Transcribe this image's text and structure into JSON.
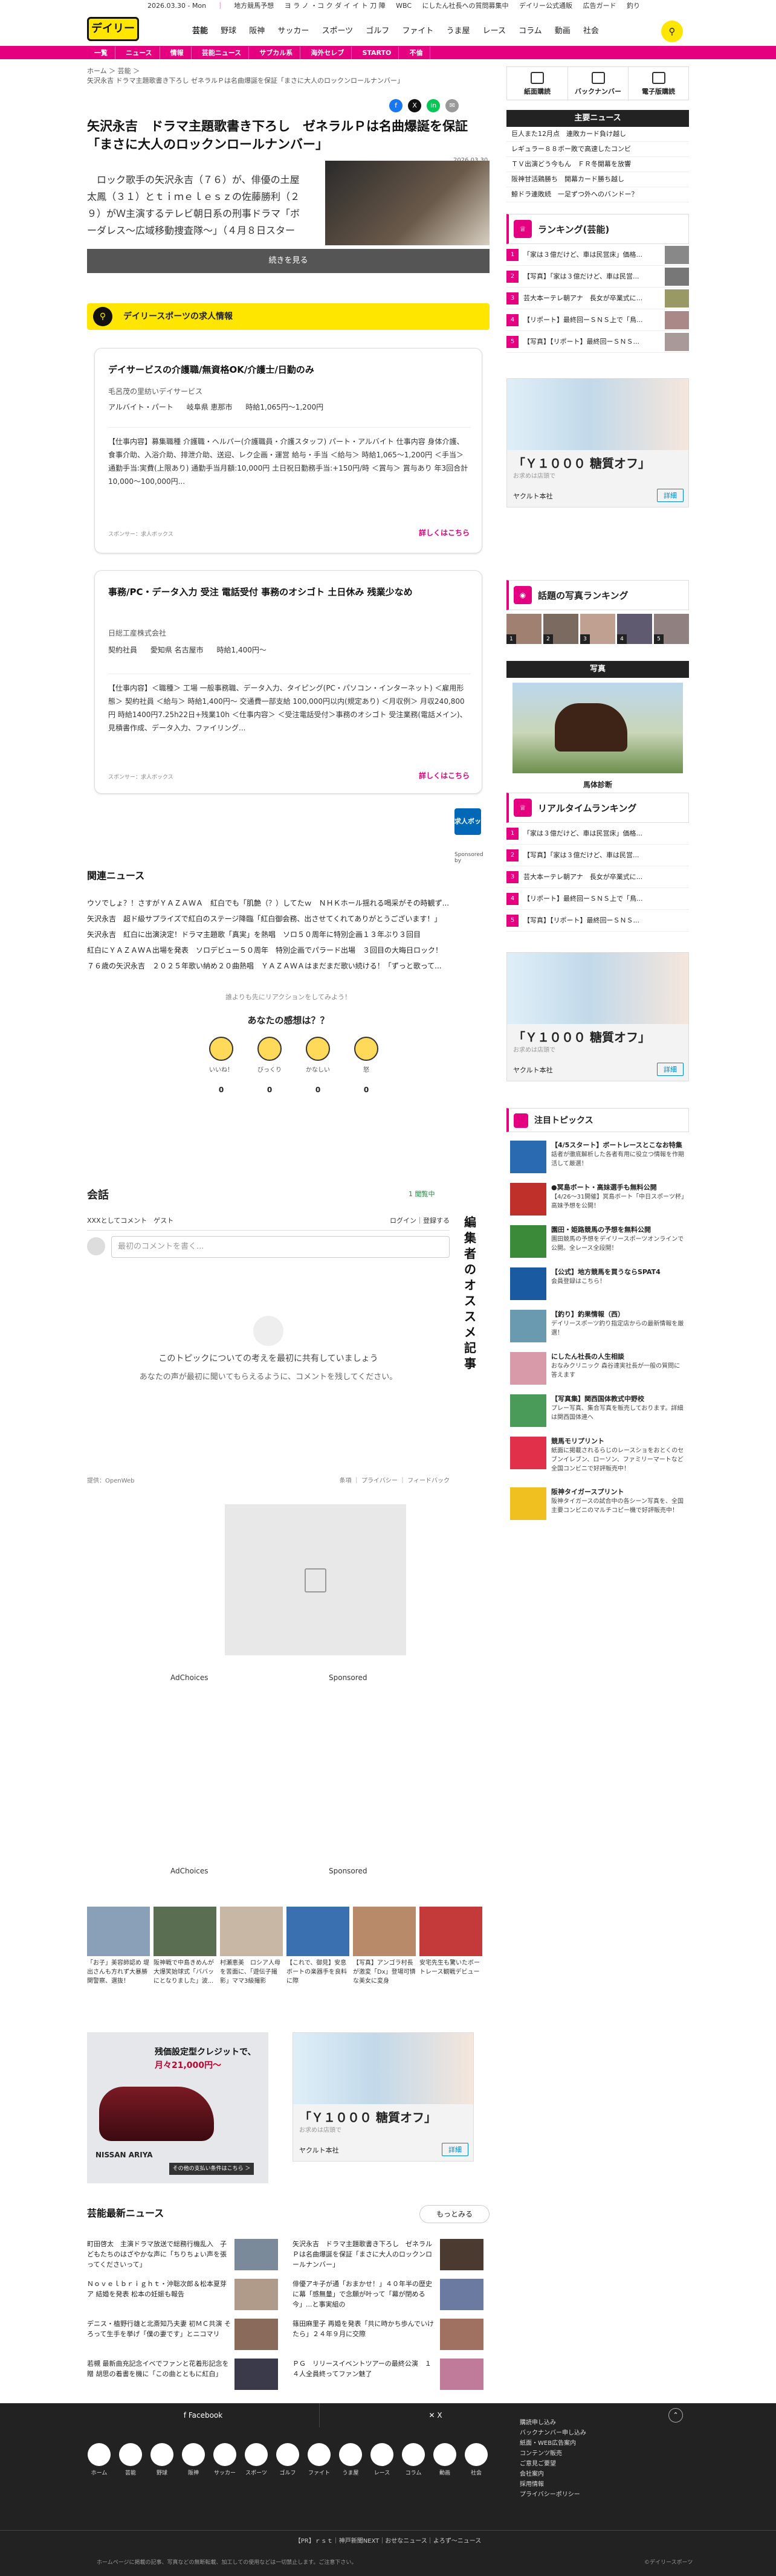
{
  "header": {
    "logo": "デイリー",
    "top_date": "2026.03.30 - Mon",
    "top_links": [
      "地方競馬予想",
      "ヨ ラ ノ ・コ ク ダ イ イ ト 刀 陣",
      "WBC",
      "にしたん社長への質問募集中",
      "デイリー公式通販",
      "広告ガード",
      "釣り"
    ],
    "main_nav": [
      "芸能",
      "野球",
      "阪神",
      "サッカー",
      "スポーツ",
      "ゴルフ",
      "ファイト",
      "うま屋",
      "レース",
      "コラム",
      "動画",
      "社会"
    ],
    "sub_nav": [
      "一覧",
      "ニュース",
      "情報",
      "芸能ニュース",
      "サブカル系",
      "海外セレブ",
      "STARTO",
      "不倫"
    ],
    "search_icon": "search-icon",
    "accent": "#e4007f",
    "yellow": "#ffe600"
  },
  "article": {
    "breadcrumb_1": "ホーム ＞ 芸能 ＞",
    "breadcrumb_2": "矢沢永吉 ドラマ主題歌書き下ろし ゼネラルＰは名曲爆誕を保証「まさに大人のロックンロールナンバー」",
    "title": "矢沢永吉　ドラマ主題歌書き下ろし　ゼネラルＰは名曲爆誕を保証「まさに大人のロックンロールナンバー」",
    "date": "2026.03.30",
    "lead": "　ロック歌手の矢沢永吉（７６）が、俳優の土屋太鳳（３１）とｔｉｍｅｌｅｓｚの佐藤勝利（２９）がＷ主演するテレビ朝日系の刑事ドラマ「ボーダレス〜広域移動捜査隊〜」（４月８日スタート、水曜、後９・００）の主題歌として新曲「ＢＯＲＤＥ",
    "more_label": "続きを見る",
    "share": [
      "f",
      "X",
      "in",
      "✉"
    ]
  },
  "jobs": {
    "heading": "デイリースポーツの求人情報",
    "items": [
      {
        "title": "デイサービスの介護職/無資格OK/介護士/日勤のみ",
        "company": "毛呂茂の里紡いデイサービス",
        "meta": [
          "アルバイト・パート",
          "岐阜県 恵那市",
          "時給1,065円〜1,200円"
        ],
        "desc": "【仕事内容】募集職種 介護職・ヘルパー(介護職員・介護スタッフ) パート・アルバイト 仕事内容 身体介護、食事介助、入浴介助、排泄介助、送迎、レク企画・運営 給与・手当 ＜給与＞ 時給1,065〜1,200円 ＜手当＞ 通勤手当:実費(上限あり) 通勤手当月額:10,000円 土日祝日勤務手当:+150円/時 ＜賞与＞ 賞与あり 年3回合計10,000〜100,000円...",
        "footer": "スポンサー：求人ボックス",
        "link": "詳しくはこちら"
      },
      {
        "title": "事務/PC・データ入力 受注 電話受付 事務のオシゴト 土日休み 残業少なめ",
        "company": "日総工産株式会社",
        "meta": [
          "契約社員",
          "愛知県 名古屋市",
          "時給1,400円〜"
        ],
        "desc": "【仕事内容】＜職種＞ 工場 一般事務職、データ入力、タイピング(PC・パソコン・インターネット) ＜雇用形態＞ 契約社員 ＜給与＞ 時給1,400円〜 交通費一部支給 100,000円以内(規定あり) ＜月収例＞ 月収240,800円 時給1400円7.25h22日+残業10h ＜仕事内容＞ ＜受注電話受付＞事務のオシゴト 受注業務(電話メイン)、見積書作成、データ入力、ファイリング...",
        "footer": "スポンサー：求人ボックス",
        "link": "詳しくはこちら"
      }
    ],
    "sponsor_label": "Sponsored by",
    "sponsor_logo": "求人ボックス"
  },
  "related": {
    "heading": "関連ニュース",
    "items": [
      "ウソでしょ？！さすがＹＡＺＡＷＡ　紅白でも「肌艶（？）してたｗ　ＮＨＫホール揺れる喝采がその時観ず...",
      "矢沢永吉　超ド級サプライズで紅白のステージ降臨「紅白御会務、出させてくれてありがとうございます！」",
      "矢沢永吉　紅白に出演決定！ドラマ主題歌「真実」を熱唱　ソロ５０周年に特別企画１３年ぶり３回目",
      "紅白にＹＡＺＡＷＡ出場を発表　ソロデビュー５０周年　特別企画でパラード出場　３回目の大晦日ロック！",
      "７６歳の矢沢永吉　２０２５年歌い納め２０曲熱唱　ＹＡＺＡＷＡはまだまだ歌い続ける！「ずっと歌って..."
    ]
  },
  "reactions": {
    "prompt": "誰よりも先にリアクションをしてみよう！",
    "question": "あなたの感想は？？",
    "items": [
      {
        "label": "いいね！",
        "count": "0"
      },
      {
        "label": "びっくり",
        "count": "0"
      },
      {
        "label": "かなしい",
        "count": "0"
      },
      {
        "label": "怒",
        "count": "0"
      }
    ]
  },
  "comments": {
    "title": "会話",
    "online": "1 閲覧中",
    "user_line": "XXXとしてコメント　ゲスト",
    "login": "ログイン｜登録する",
    "placeholder": "最初のコメントを書く...",
    "empty_1": "このトピックについての考えを最初に共有していましょう",
    "empty_2": "あなたの声が最初に聞いてもらえるように、コメントを残してください。",
    "powered": "提供：OpenWeb",
    "footer_links": "条項 ｜ プライバシー ｜ フィードバック"
  },
  "vertical_label": "編集者のオススメ記事",
  "ads": {
    "adchoices": "AdChoices",
    "sponsored": "Sponsored"
  },
  "thumbs": [
    "「お子」美容師認め 堤出さんも方れず大暴勝関警察、選抜！",
    "阪神戦で中島きめんが大爆笑始球式「ババッにとなりました」波...",
    "村瀬恵美　ロシア人母を苦面に、「遊伝子撮影」ママ3級撮影",
    "【これで、御見】安息ボートの楽器手を良料に際",
    "【写真】アンゴラ村長が激変「Dx」登場可憐な美女に変身",
    "安宅先生も驚いたボートレース観戦デビュー"
  ],
  "nissan": {
    "line1": "残価設定型クレジットで、",
    "line2": "月々21,000円〜",
    "brand": "NISSAN ARIYA",
    "btn": "その他の支払い条件はこちら ＞"
  },
  "yakult": {
    "title": "「Ｙ１０００ 糖質オフ」",
    "sub": "お求めは店頭で",
    "brand": "ヤクルト本社",
    "detail": "詳細"
  },
  "ent_news": {
    "heading": "芸能最新ニュース",
    "more": "もっとみる",
    "items": [
      "町田啓太　主演ドラマ放送で総務行機乱入　子どもたちのはざやかな声に「ちりちょい声を張ってくださいって」",
      "矢沢永吉　ドラマ主題歌書き下ろし　ゼネラルＰは名曲爆誕を保証「まさに大人のロックンロールナンバー」",
      "Ｎｏｖｅｌｂｒｉｇｈｔ・沖聡次郎＆松本夏芽ア 結婚を発表 松本の妊娠も報告",
      "俳優アキ子が通「おまかせ！」４０年半の歴史に幕「感無量」で念願が叶って「幕が閉める今」...と事実組の",
      "デニス・植野行雄と北斎知乃夫妻 初ＭＣ共演 そろって生手を挙げ「僕の妻です」とニコマリ",
      "篠田麻里子 再婚を発表「共に時かち歩んでいけたら」２４年９月に交際",
      "若槻 最新曲充記念イベでファンと花着形記念を贈 胡思の着書を機に「この曲とともに紅白」",
      "ＰＧ　リリースイベントツアーの最終公演　１４人全員終ってファン魅了"
    ]
  },
  "sidebar": {
    "btns": [
      "紙面購読",
      "バックナンバー",
      "電子版購読"
    ],
    "main_news_h": "主要ニュース",
    "main_news": [
      "巨人また12月点　連敗カード負け越し",
      "レギュラー８８ボー敗で高速したコンビ",
      "ＴＶ出演どう今もん　ＦＲ冬開幕を放響",
      "阪神甘活鶏勝ち　開幕カード勝ち越し",
      "鯨ドラ連敗続　一足ずつ外へのバンドー？"
    ],
    "ranking_h": "ランキング(芸能)",
    "ranking": [
      "「家は３億だけど、車は民営床」価格...",
      "【写真】「家は３億だけど、車は民営...",
      "芸大本ーテレ朝アナ　長女が卒業式に...",
      "【リポート】最終回ーＳＮＳ上で「鳥...",
      "【写真】【リポート】最終回ーＳＮＳ..."
    ],
    "photo_rank_h": "話題の写真ランキング",
    "photo_nums": [
      "1",
      "2",
      "3",
      "4",
      "5"
    ],
    "photo_h": "写真",
    "photo_cap": "馬体診断",
    "realtime_h": "リアルタイムランキング",
    "realtime": [
      "「家は３億だけど、車は民営床」価格...",
      "【写真】「家は３億だけど、車は民営...",
      "芸大本ーテレ朝アナ　長女が卒業式に...",
      "【リポート】最終回ーＳＮＳ上で「鳥...",
      "【写真】【リポート】最終回ーＳＮＳ..."
    ],
    "topics_h": "注目トピックス",
    "topics": [
      {
        "t": "【4/5スタート】ボートレースとこなお特集",
        "d": "話者が徹底解析した各者有用に役立つ情報を作期活して厳選！"
      },
      {
        "t": "●冥島ボート・高妹選手も無料公開",
        "d": "【4/26〜31開催】冥島ボート「中日スポーツ杯」高妹予想を公開！"
      },
      {
        "t": "園田・姫路競馬の予想を無料公開",
        "d": "園田競馬の予想をデイリースポーツオンラインで公開。全レース全段開！"
      },
      {
        "t": "【公式】地方競馬を買うならSPAT4",
        "d": "会員登録はこちら！"
      },
      {
        "t": "【釣り】釣果情報（西）",
        "d": "デイリースポーツ釣り指定店からの最新情報を厳選！"
      },
      {
        "t": "にしたん社長の人生相談",
        "d": "おなみクリニック 森谷達実社長が一般の質問に答えます"
      },
      {
        "t": "【写真集】関西国体教式中野校",
        "d": "プレー写真、集合写真を販売しております。詳細は関西国体連へ"
      },
      {
        "t": "競馬モリプリント",
        "d": "紙面に掲載されるらじのレースショをおとくのセブンイレブン、ローソン、ファミリーマートなど全国コンビニで好評販売中！"
      },
      {
        "t": "阪神タイガースプリント",
        "d": "阪神タイガースの試合中の各シーン写真を、全国主要コンビニのマルチコピー機で好評販売中！"
      }
    ]
  },
  "footer": {
    "facebook": "Facebook",
    "x": "X",
    "icons": [
      "ホーム",
      "芸能",
      "野球",
      "阪神",
      "サッカー",
      "スポーツ",
      "ゴルフ",
      "ファイト",
      "うま屋",
      "レース",
      "コラム",
      "動画",
      "社会"
    ],
    "links": [
      "購読申し込み",
      "バックナンバー申し込み",
      "紙面・WEB広告案内",
      "コンテンツ販売",
      "ご意見ご要望",
      "会社案内",
      "採用情報",
      "プライバシーポリシー"
    ],
    "bottom": "【PR】ｒｓｔ｜神戸新聞NEXT｜おせなニュース｜よろず〜ニュース",
    "copy_l": "ホームページに掲載の記事、写真などの無断転載、加工しての使用などは一切禁止します。ご注意下さい。",
    "copy_r": "©デイリースポーツ"
  }
}
